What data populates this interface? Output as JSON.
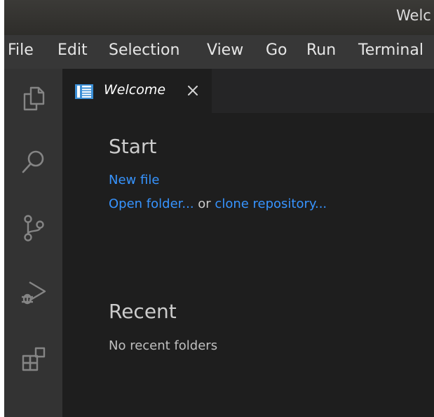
{
  "window": {
    "title": "Welcome - Visual Studio Code",
    "title_visible": "Welc"
  },
  "menubar": {
    "items": [
      "File",
      "Edit",
      "Selection",
      "View",
      "Go",
      "Run",
      "Terminal"
    ]
  },
  "activitybar": {
    "icons": [
      "explorer-icon",
      "search-icon",
      "source-control-icon",
      "run-debug-icon",
      "extensions-icon"
    ]
  },
  "tabs": [
    {
      "label": "Welcome",
      "icon": "vscode-welcome-icon",
      "active": true
    }
  ],
  "welcome": {
    "start_heading": "Start",
    "new_file": "New file",
    "open_folder": "Open folder...",
    "or_text": " or ",
    "clone_repository": "clone repository...",
    "recent_heading": "Recent",
    "no_recent": "No recent folders"
  },
  "colors": {
    "link": "#3794ff",
    "activitybar": "#333333",
    "editor_bg": "#1e1e1e",
    "menubar": "#373737"
  }
}
